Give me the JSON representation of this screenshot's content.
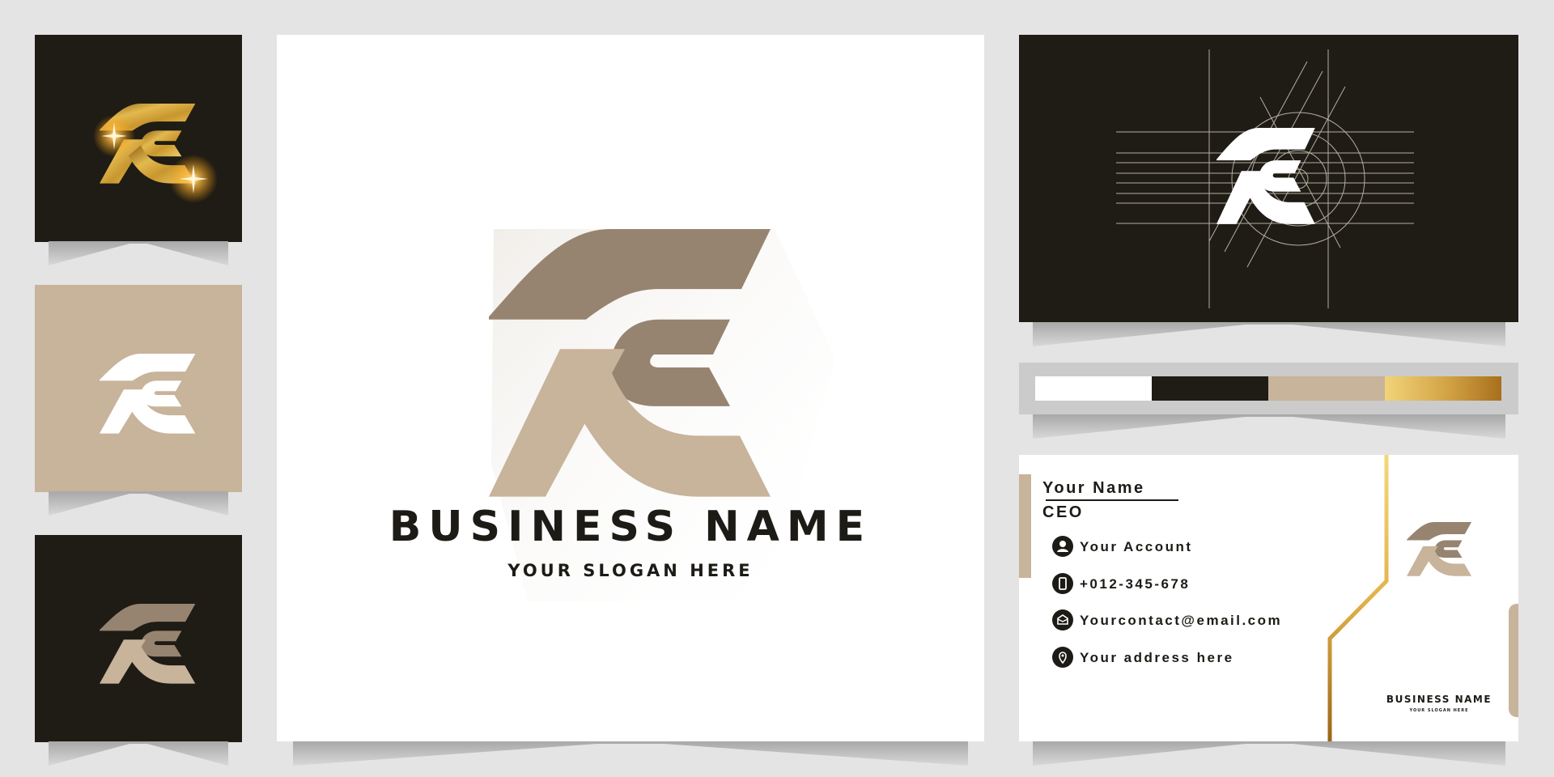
{
  "brand": {
    "monogram": "AC",
    "business_name": "BUSINESS NAME",
    "slogan": "YOUR SLOGAN HERE"
  },
  "colors": {
    "background": "#e4e4e4",
    "dark": "#1f1c15",
    "tan_light": "#c8b39b",
    "tan_dark": "#978470",
    "white": "#ffffff",
    "gold_light": "#f2d479",
    "gold_dark": "#a86f1c"
  },
  "tiles": [
    {
      "variant": "gold-on-dark"
    },
    {
      "variant": "white-on-tan"
    },
    {
      "variant": "tan-on-dark"
    }
  ],
  "palette": [
    "#ffffff",
    "#1f1c15",
    "#c8b39b",
    "gold-gradient"
  ],
  "business_card": {
    "name": "Your Name",
    "title": "CEO",
    "contacts": [
      {
        "icon": "user-icon",
        "text": "Your Account"
      },
      {
        "icon": "phone-icon",
        "text": "+012-345-678"
      },
      {
        "icon": "mail-icon",
        "text": "Yourcontact@email.com"
      },
      {
        "icon": "location-pin-icon",
        "text": "Your address here"
      }
    ],
    "business_name": "BUSINESS NAME",
    "slogan": "YOUR SLOGAN HERE"
  }
}
